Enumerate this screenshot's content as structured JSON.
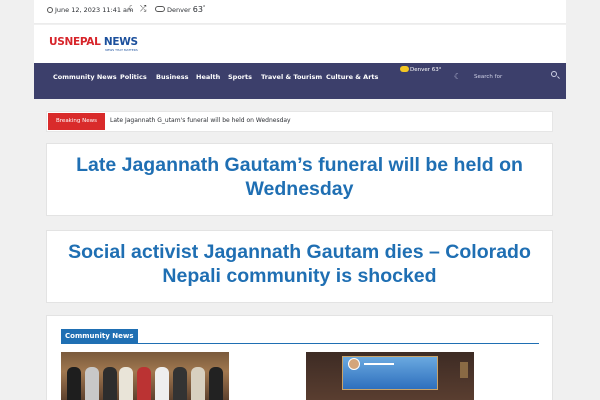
{
  "topbar": {
    "date": "June 12, 2023 11:41 am",
    "weather_city": "Denver",
    "weather_temp": "63",
    "weather_unit": "°"
  },
  "logo": {
    "part1": "USNEPAL",
    "part2": "NEWS",
    "tagline": "NEWS THAT MATTERS"
  },
  "nav": {
    "items": [
      "Community News",
      "Politics",
      "Business",
      "Health",
      "Sports",
      "Travel & Tourism",
      "Culture & Arts"
    ],
    "weather": "Denver 63°",
    "search_placeholder": "Search for"
  },
  "breaking": {
    "label": "Breaking News",
    "ticker": "Late Jagannath G_utam's funeral will be held on Wednesday"
  },
  "headlines": [
    "Late Jagannath Gautam’s funeral will be held on Wednesday",
    "Social activist Jagannath Gautam dies – Colorado Nepali community is shocked"
  ],
  "section": {
    "title": "Community News"
  },
  "colors": {
    "nav_bg": "#3c3f6b",
    "accent_blue": "#1f6fb3",
    "breaking_red": "#d92b2b",
    "logo_red": "#d7242a"
  },
  "icons": {
    "clock": "clock-icon",
    "moon": "moon-icon",
    "shuffle": "shuffle-icon",
    "cloud": "cloud-icon",
    "search": "search-icon"
  }
}
